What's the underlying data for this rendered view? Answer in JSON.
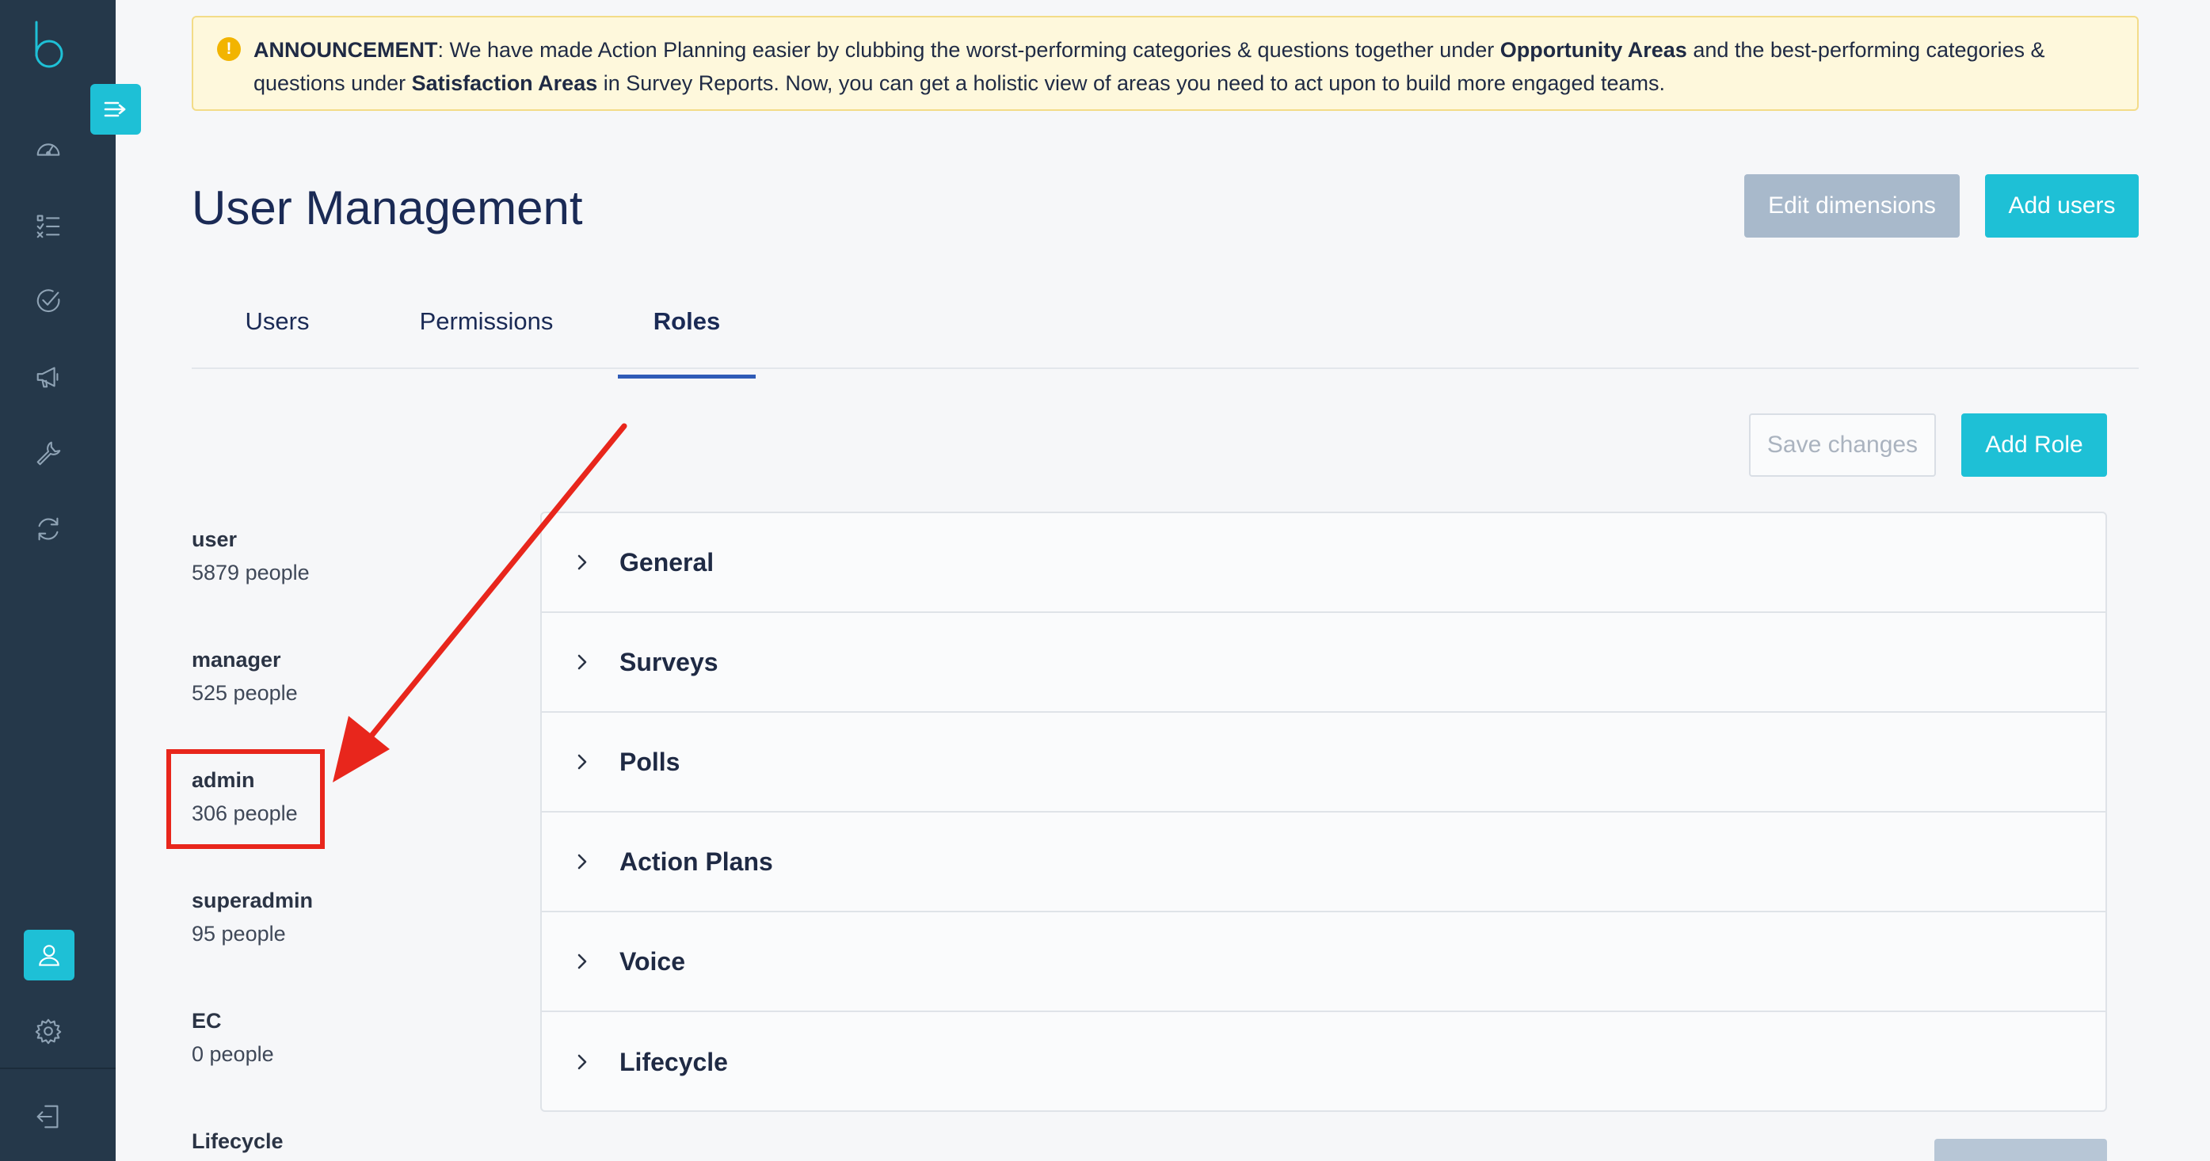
{
  "announcement": {
    "prefix": "ANNOUNCEMENT",
    "part1": ": We have made Action Planning easier by clubbing the worst-performing categories & questions  together under ",
    "bold1": "Opportunity Areas",
    "part2": " and the best-performing  categories & questions under ",
    "bold2": "Satisfaction Areas",
    "part3": " in Survey Reports.  Now, you can get a holistic view of areas you need to act upon to build more engaged teams."
  },
  "page": {
    "title": "User Management",
    "edit_dimensions_label": "Edit dimensions",
    "add_users_label": "Add users"
  },
  "tabs": {
    "users": "Users",
    "permissions": "Permissions",
    "roles": "Roles",
    "active": "Roles"
  },
  "roles_actions": {
    "save_label": "Save changes",
    "add_role_label": "Add Role"
  },
  "roles": [
    {
      "name": "user",
      "count": "5879 people"
    },
    {
      "name": "manager",
      "count": "525 people"
    },
    {
      "name": "admin",
      "count": "306 people"
    },
    {
      "name": "superadmin",
      "count": "95 people"
    },
    {
      "name": "EC",
      "count": "0 people"
    },
    {
      "name": "Lifecycle",
      "count": ""
    }
  ],
  "permission_sections": [
    "General",
    "Surveys",
    "Polls",
    "Action Plans",
    "Voice",
    "Lifecycle"
  ],
  "sidebar": {
    "icons": [
      "dashboard-icon",
      "checklist-icon",
      "check-circle-icon",
      "megaphone-icon",
      "wrench-icon",
      "sync-icon",
      "user-icon",
      "gear-icon",
      "logout-icon"
    ],
    "active": "user-icon"
  },
  "colors": {
    "sidebar": "#25384a",
    "accent": "#1ec0d6",
    "tab_underline": "#2f5bb7",
    "annotation": "#e8261c"
  }
}
